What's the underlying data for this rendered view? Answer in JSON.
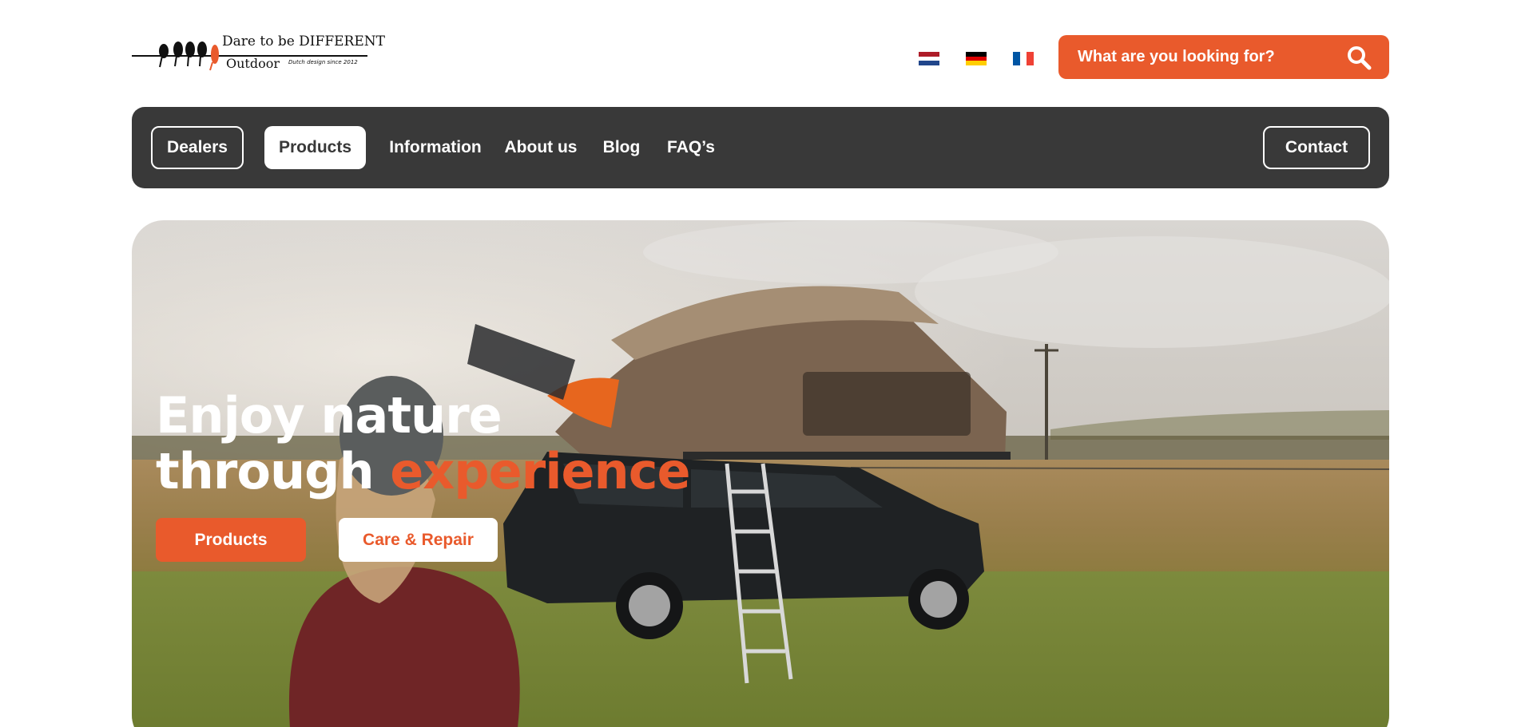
{
  "header": {
    "logo": {
      "tagline": "Dare to be DIFFERENT",
      "brand": "Outdoor",
      "sub": "Dutch design since 2012"
    },
    "flags": [
      {
        "lang": "nl",
        "colors": [
          "#ae1c28",
          "#ffffff",
          "#21468b"
        ]
      },
      {
        "lang": "de",
        "colors": [
          "#000000",
          "#dd0000",
          "#ffce00"
        ]
      },
      {
        "lang": "fr",
        "colors": [
          "#0055a4",
          "#ffffff",
          "#ef4135"
        ]
      }
    ],
    "search": {
      "placeholder": "What are you looking for?",
      "icon": "search-icon"
    }
  },
  "nav": {
    "items": [
      {
        "label": "Dealers",
        "style": "outline"
      },
      {
        "label": "Products",
        "style": "filled",
        "active": true
      },
      {
        "label": "Information"
      },
      {
        "label": "About us"
      },
      {
        "label": "Blog"
      },
      {
        "label": "FAQ’s"
      }
    ],
    "contact": "Contact"
  },
  "hero": {
    "title_line1": "Enjoy nature",
    "title_line2_plain": "through ",
    "title_line2_accent": "experience",
    "buttons": {
      "primary": "Products",
      "secondary": "Care & Repair"
    }
  },
  "colors": {
    "accent": "#e95a2c",
    "nav_bg": "#393939",
    "white": "#ffffff"
  }
}
